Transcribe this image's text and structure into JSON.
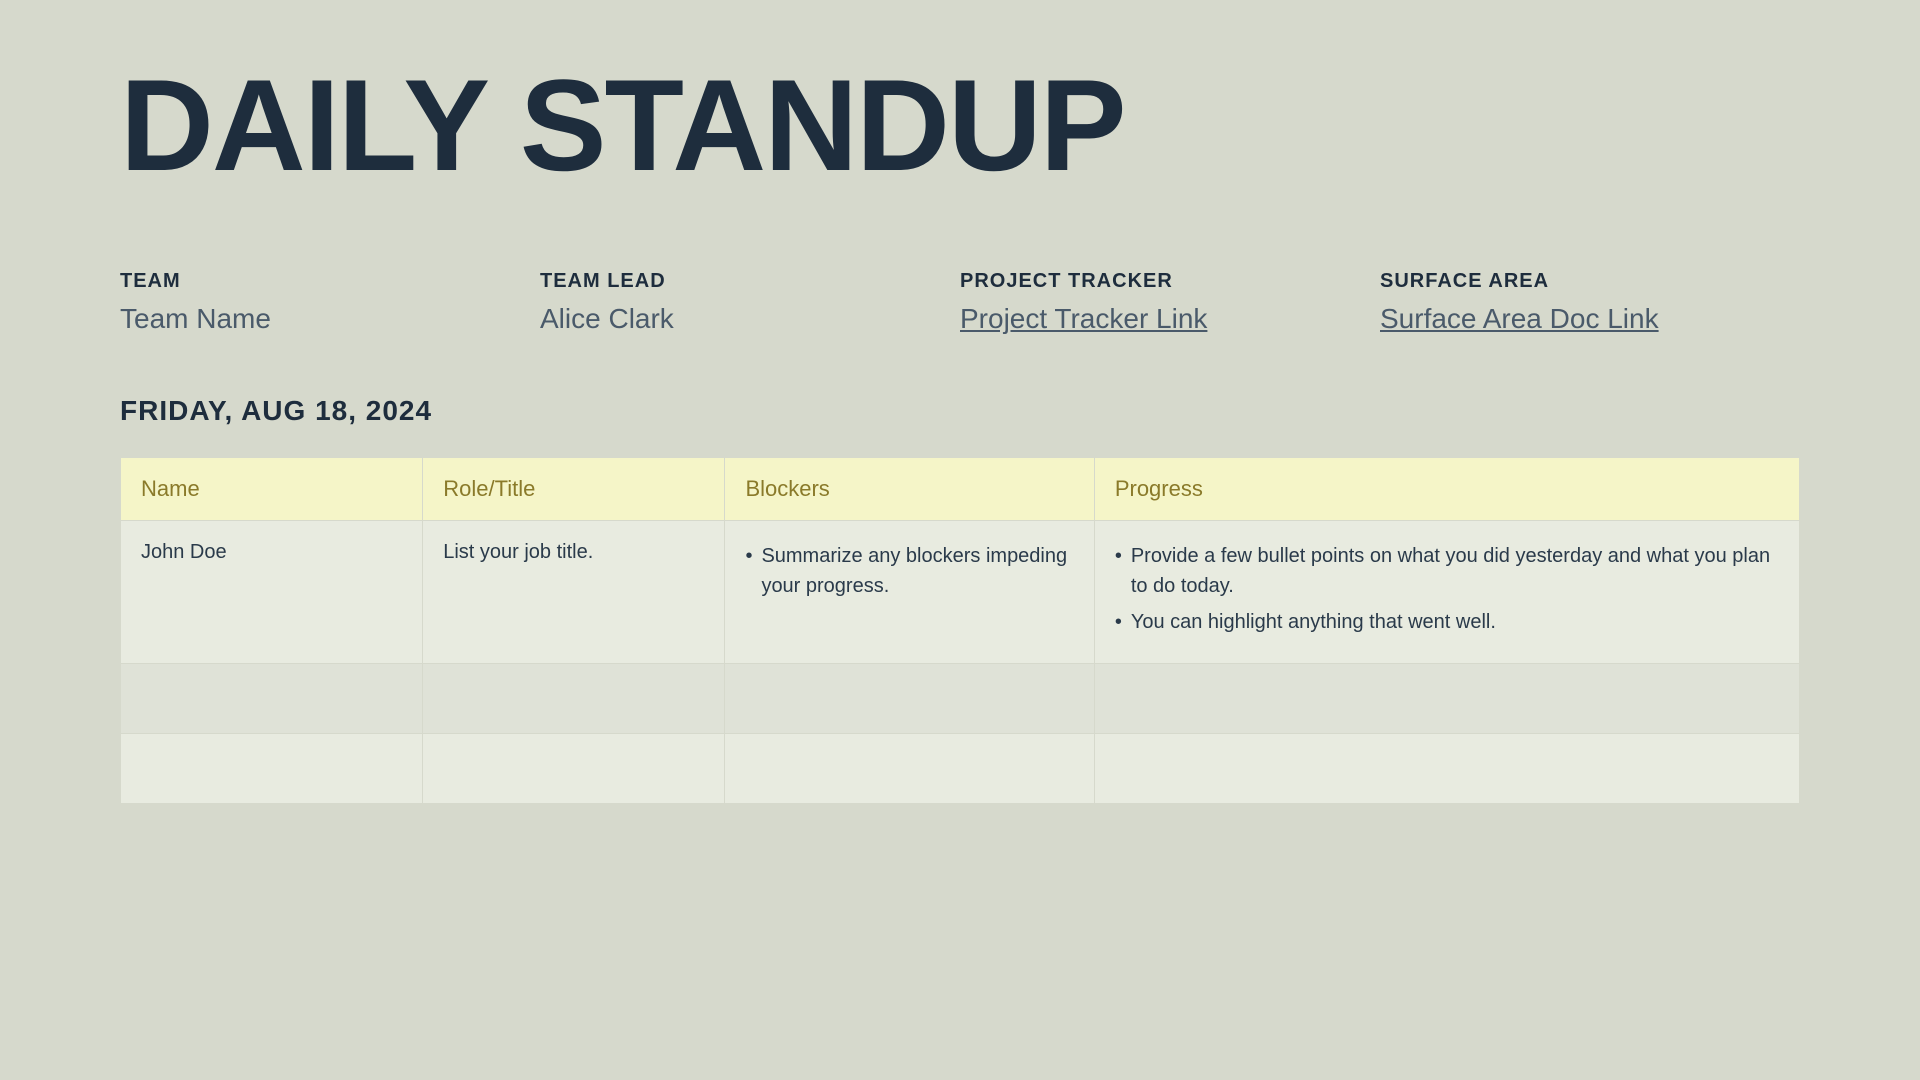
{
  "title": "DAILY STANDUP",
  "meta": {
    "team": {
      "label": "TEAM",
      "value": "Team Name"
    },
    "team_lead": {
      "label": "TEAM LEAD",
      "value": "Alice Clark"
    },
    "project_tracker": {
      "label": "PROJECT TRACKER",
      "value": "Project Tracker Link"
    },
    "surface_area": {
      "label": "SURFACE AREA",
      "value": "Surface Area Doc Link"
    }
  },
  "date": {
    "label": "FRIDAY, AUG 18, 2024"
  },
  "table": {
    "headers": {
      "name": "Name",
      "role": "Role/Title",
      "blockers": "Blockers",
      "progress": "Progress"
    },
    "rows": [
      {
        "name": "John Doe",
        "role": "List your job title.",
        "blockers": "Summarize any blockers impeding your progress.",
        "progress_items": [
          "Provide a few bullet points on what you did yesterday and what you plan to do today.",
          "You can highlight anything that went well."
        ]
      }
    ]
  },
  "colors": {
    "background": "#d6d9cc",
    "title": "#1e2d3d",
    "table_header_bg": "#f5f5c8",
    "table_header_text": "#8a7a2a",
    "table_cell_bg": "#e8ebe0"
  }
}
